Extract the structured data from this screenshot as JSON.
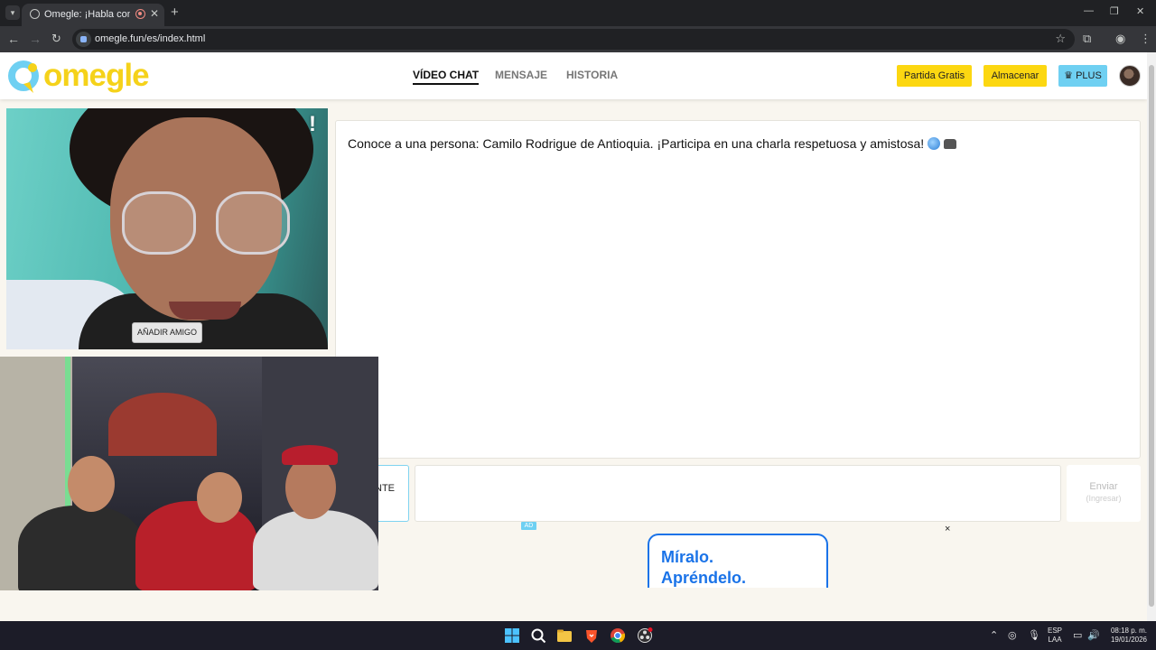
{
  "browser": {
    "tab_title": "Omegle: ¡Habla con Descon",
    "tab_close": "✕",
    "new_tab": "+",
    "url": "omegle.fun/es/index.html",
    "window_controls": {
      "minimize": "—",
      "maximize": "❐",
      "close": "✕"
    }
  },
  "site": {
    "logo_text": "omegle",
    "nav": [
      {
        "label": "VÍDEO CHAT",
        "active": true
      },
      {
        "label": "MENSAJE",
        "active": false
      },
      {
        "label": "HISTORIA",
        "active": false
      }
    ],
    "buttons": {
      "free_match": "Partida Gratis",
      "store": "Almacenar",
      "plus": "PLUS"
    },
    "colors": {
      "logo_yellow": "#f5d21a",
      "button_yellow": "#fcd711",
      "plus_blue": "#6fd0f2"
    }
  },
  "remote": {
    "report_label": "!",
    "add_friend_label": "AÑADIR AMIGO"
  },
  "chat": {
    "message": "Conoce a una persona: Camilo Rodrigue de Antioquia. ¡Participa en una charla respetuosa y amistosa!",
    "message_icons": [
      "globe-icon",
      "telephone-icon"
    ],
    "next_label": "NTE",
    "send_label": "Enviar",
    "send_hint": "(Ingresar)"
  },
  "ad": {
    "tag": "AD",
    "close": "×",
    "line1": "Míralo.",
    "line2": "Apréndelo."
  },
  "taskbar": {
    "lang_line1": "ESP",
    "lang_line2": "LAA",
    "time": "08:18 p. m.",
    "date": "19/01/2026"
  }
}
